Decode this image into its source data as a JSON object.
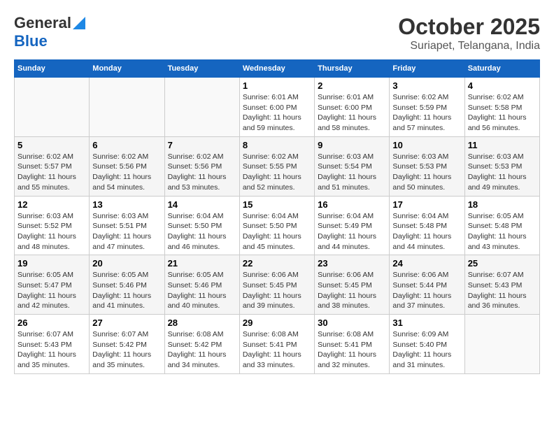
{
  "logo": {
    "line1": "General",
    "line2": "Blue"
  },
  "title": "October 2025",
  "subtitle": "Suriapet, Telangana, India",
  "weekdays": [
    "Sunday",
    "Monday",
    "Tuesday",
    "Wednesday",
    "Thursday",
    "Friday",
    "Saturday"
  ],
  "weeks": [
    [
      {
        "day": "",
        "info": ""
      },
      {
        "day": "",
        "info": ""
      },
      {
        "day": "",
        "info": ""
      },
      {
        "day": "1",
        "info": "Sunrise: 6:01 AM\nSunset: 6:00 PM\nDaylight: 11 hours\nand 59 minutes."
      },
      {
        "day": "2",
        "info": "Sunrise: 6:01 AM\nSunset: 6:00 PM\nDaylight: 11 hours\nand 58 minutes."
      },
      {
        "day": "3",
        "info": "Sunrise: 6:02 AM\nSunset: 5:59 PM\nDaylight: 11 hours\nand 57 minutes."
      },
      {
        "day": "4",
        "info": "Sunrise: 6:02 AM\nSunset: 5:58 PM\nDaylight: 11 hours\nand 56 minutes."
      }
    ],
    [
      {
        "day": "5",
        "info": "Sunrise: 6:02 AM\nSunset: 5:57 PM\nDaylight: 11 hours\nand 55 minutes."
      },
      {
        "day": "6",
        "info": "Sunrise: 6:02 AM\nSunset: 5:56 PM\nDaylight: 11 hours\nand 54 minutes."
      },
      {
        "day": "7",
        "info": "Sunrise: 6:02 AM\nSunset: 5:56 PM\nDaylight: 11 hours\nand 53 minutes."
      },
      {
        "day": "8",
        "info": "Sunrise: 6:02 AM\nSunset: 5:55 PM\nDaylight: 11 hours\nand 52 minutes."
      },
      {
        "day": "9",
        "info": "Sunrise: 6:03 AM\nSunset: 5:54 PM\nDaylight: 11 hours\nand 51 minutes."
      },
      {
        "day": "10",
        "info": "Sunrise: 6:03 AM\nSunset: 5:53 PM\nDaylight: 11 hours\nand 50 minutes."
      },
      {
        "day": "11",
        "info": "Sunrise: 6:03 AM\nSunset: 5:53 PM\nDaylight: 11 hours\nand 49 minutes."
      }
    ],
    [
      {
        "day": "12",
        "info": "Sunrise: 6:03 AM\nSunset: 5:52 PM\nDaylight: 11 hours\nand 48 minutes."
      },
      {
        "day": "13",
        "info": "Sunrise: 6:03 AM\nSunset: 5:51 PM\nDaylight: 11 hours\nand 47 minutes."
      },
      {
        "day": "14",
        "info": "Sunrise: 6:04 AM\nSunset: 5:50 PM\nDaylight: 11 hours\nand 46 minutes."
      },
      {
        "day": "15",
        "info": "Sunrise: 6:04 AM\nSunset: 5:50 PM\nDaylight: 11 hours\nand 45 minutes."
      },
      {
        "day": "16",
        "info": "Sunrise: 6:04 AM\nSunset: 5:49 PM\nDaylight: 11 hours\nand 44 minutes."
      },
      {
        "day": "17",
        "info": "Sunrise: 6:04 AM\nSunset: 5:48 PM\nDaylight: 11 hours\nand 44 minutes."
      },
      {
        "day": "18",
        "info": "Sunrise: 6:05 AM\nSunset: 5:48 PM\nDaylight: 11 hours\nand 43 minutes."
      }
    ],
    [
      {
        "day": "19",
        "info": "Sunrise: 6:05 AM\nSunset: 5:47 PM\nDaylight: 11 hours\nand 42 minutes."
      },
      {
        "day": "20",
        "info": "Sunrise: 6:05 AM\nSunset: 5:46 PM\nDaylight: 11 hours\nand 41 minutes."
      },
      {
        "day": "21",
        "info": "Sunrise: 6:05 AM\nSunset: 5:46 PM\nDaylight: 11 hours\nand 40 minutes."
      },
      {
        "day": "22",
        "info": "Sunrise: 6:06 AM\nSunset: 5:45 PM\nDaylight: 11 hours\nand 39 minutes."
      },
      {
        "day": "23",
        "info": "Sunrise: 6:06 AM\nSunset: 5:45 PM\nDaylight: 11 hours\nand 38 minutes."
      },
      {
        "day": "24",
        "info": "Sunrise: 6:06 AM\nSunset: 5:44 PM\nDaylight: 11 hours\nand 37 minutes."
      },
      {
        "day": "25",
        "info": "Sunrise: 6:07 AM\nSunset: 5:43 PM\nDaylight: 11 hours\nand 36 minutes."
      }
    ],
    [
      {
        "day": "26",
        "info": "Sunrise: 6:07 AM\nSunset: 5:43 PM\nDaylight: 11 hours\nand 35 minutes."
      },
      {
        "day": "27",
        "info": "Sunrise: 6:07 AM\nSunset: 5:42 PM\nDaylight: 11 hours\nand 35 minutes."
      },
      {
        "day": "28",
        "info": "Sunrise: 6:08 AM\nSunset: 5:42 PM\nDaylight: 11 hours\nand 34 minutes."
      },
      {
        "day": "29",
        "info": "Sunrise: 6:08 AM\nSunset: 5:41 PM\nDaylight: 11 hours\nand 33 minutes."
      },
      {
        "day": "30",
        "info": "Sunrise: 6:08 AM\nSunset: 5:41 PM\nDaylight: 11 hours\nand 32 minutes."
      },
      {
        "day": "31",
        "info": "Sunrise: 6:09 AM\nSunset: 5:40 PM\nDaylight: 11 hours\nand 31 minutes."
      },
      {
        "day": "",
        "info": ""
      }
    ]
  ]
}
